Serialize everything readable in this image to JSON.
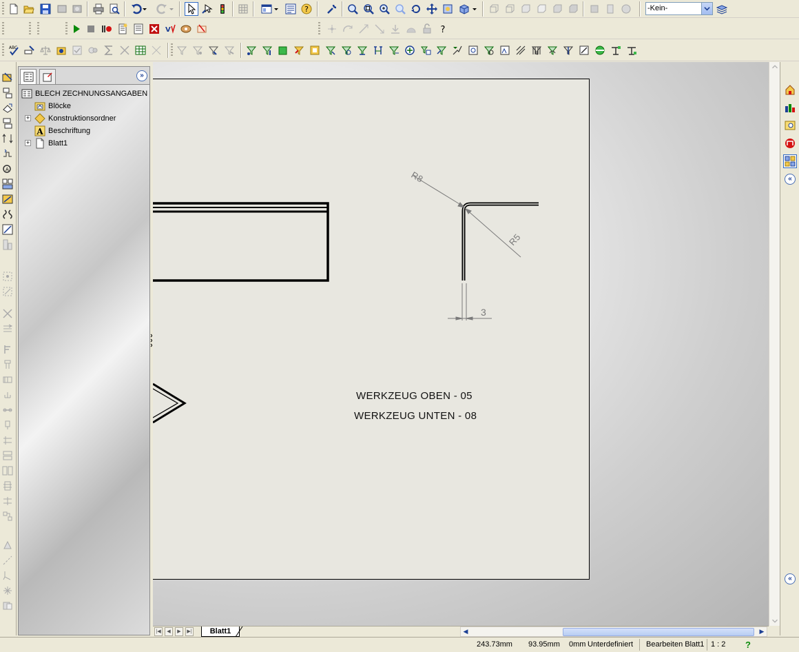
{
  "toolbar": {
    "row1_icons": [
      "new-document-icon",
      "open-folder-icon",
      "save-icon",
      "print-icon",
      "print-preview-icon",
      "undo-icon",
      "redo-icon",
      "select-arrow-icon",
      "smart-select-icon",
      "traffic-light-icon",
      "grid-icon",
      "view-layout-icon",
      "properties-icon",
      "help-icon",
      "wrench-icon",
      "zoom-to-fit-icon",
      "zoom-area-icon",
      "zoom-in-out-icon",
      "zoom-selection-icon",
      "rotate-icon",
      "pan-icon",
      "redraw-icon",
      "view-orientation-icon",
      "front-view-icon",
      "back-view-icon",
      "left-view-icon",
      "right-view-icon",
      "top-view-icon",
      "bottom-view-icon",
      "shaded-icon",
      "wireframe-icon",
      "sphere-icon",
      "layer-icon"
    ],
    "layer_combo_value": "-Kein-",
    "row2_icons": [
      "play-macro-icon",
      "stop-macro-icon",
      "record-macro-icon",
      "new-macro-icon",
      "edit-macro-icon",
      "close-macro-icon",
      "vba-icon",
      "custom-command-icon",
      "settings-icon",
      "point-icon",
      "arc-icon",
      "line-icon",
      "angle-icon",
      "baseline-icon",
      "dome-icon",
      "lock-icon",
      "help-question-icon"
    ],
    "row3_icons": [
      "spell-check-icon",
      "measure-icon",
      "balance-icon",
      "mass-properties-icon",
      "check-icon",
      "section-icon",
      "sum-icon",
      "cut-icon",
      "table-icon",
      "flag-icon",
      "filter-icon",
      "filter-vertex-icon",
      "filter-edge-icon",
      "filter-face-icon",
      "filter-point-icon",
      "filter-axis-icon",
      "filter-plane-icon",
      "filter-sketch-icon",
      "filter-dimension-icon",
      "filter-note-icon",
      "filter-balloon-icon",
      "filter-datum-icon",
      "filter-weld-icon",
      "filter-surface-icon",
      "filter-block-icon",
      "filter-table-icon",
      "filter-hole-icon",
      "filter-cosmetic-icon",
      "filter-center-icon",
      "filter-gtol-icon",
      "filter-bom-icon",
      "filter-revision-icon",
      "filter-datum-target-icon",
      "filter-symbol-icon",
      "filter-origin-icon",
      "filter-solid-icon",
      "filter-all-icon",
      "filter-toggle-icon"
    ]
  },
  "feature_manager": {
    "root_label": "BLECH ZECHNUNGSANGABEN",
    "items": [
      {
        "label": "Blöcke",
        "icon": "blocks-folder-icon",
        "expandable": false
      },
      {
        "label": "Konstruktionsordner",
        "icon": "design-folder-icon",
        "expandable": true
      },
      {
        "label": "Beschriftung",
        "icon": "annotation-icon",
        "expandable": false
      },
      {
        "label": "Blatt1",
        "icon": "sheet-icon",
        "expandable": true
      }
    ],
    "collapse_symbol": "»"
  },
  "drawing": {
    "radius_outer_label": "R8",
    "radius_inner_label": "R5",
    "thickness_label": "3",
    "tool_top": "WERKZEUG OBEN -  05",
    "tool_bottom": "WERKZEUG UNTEN -  08"
  },
  "sheet_tabs": {
    "active": "Blatt1"
  },
  "right_panel": {
    "icons": [
      "home-icon",
      "resources-icon",
      "search-library-icon",
      "design-library-icon",
      "view-palette-icon"
    ],
    "collapse_symbol": "«"
  },
  "statusbar": {
    "x": "243.73mm",
    "y": "93.95mm",
    "z": "0mm",
    "state": "Unterdefiniert",
    "editing": "Bearbeiten Blatt1",
    "scale": "1 : 2",
    "help": "?"
  },
  "colors": {
    "sheet": "#e8e7e0",
    "geometry": "#000000",
    "dimension": "#7a7a7a",
    "accent": "#1c3f94"
  }
}
